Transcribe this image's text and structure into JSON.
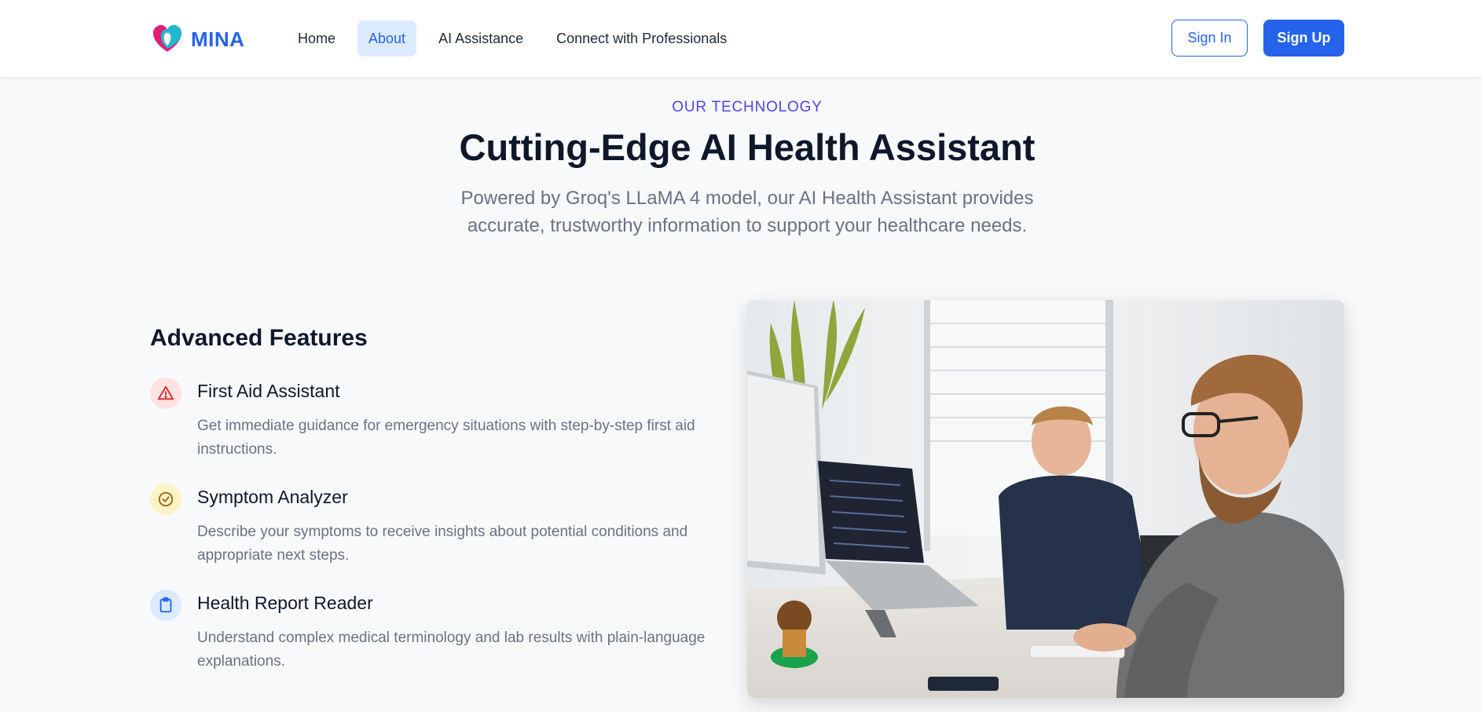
{
  "brand": {
    "name": "MINA",
    "logo_icon": "heart-icon"
  },
  "nav": {
    "items": [
      {
        "label": "Home",
        "active": false
      },
      {
        "label": "About",
        "active": true
      },
      {
        "label": "AI Assistance",
        "active": false
      },
      {
        "label": "Connect with Professionals",
        "active": false
      }
    ]
  },
  "auth": {
    "sign_in": "Sign In",
    "sign_up": "Sign Up"
  },
  "hero": {
    "eyebrow": "OUR TECHNOLOGY",
    "title": "Cutting-Edge AI Health Assistant",
    "subtitle": "Powered by Groq's LLaMA 4 model, our AI Health Assistant provides accurate, trustworthy information to support your healthcare needs."
  },
  "features": {
    "title": "Advanced Features",
    "items": [
      {
        "icon": "warning-triangle-icon",
        "name": "First Aid Assistant",
        "description": "Get immediate guidance for emergency situations with step-by-step first aid instructions."
      },
      {
        "icon": "check-circle-icon",
        "name": "Symptom Analyzer",
        "description": "Describe your symptoms to receive insights about potential conditions and appropriate next steps."
      },
      {
        "icon": "clipboard-icon",
        "name": "Health Report Reader",
        "description": "Understand complex medical terminology and lab results with plain-language explanations."
      }
    ]
  },
  "colors": {
    "primary": "#2563eb",
    "eyebrow": "#4f46e5",
    "heading": "#0f172a",
    "muted": "#6b7280",
    "background": "#f8f9fb"
  }
}
